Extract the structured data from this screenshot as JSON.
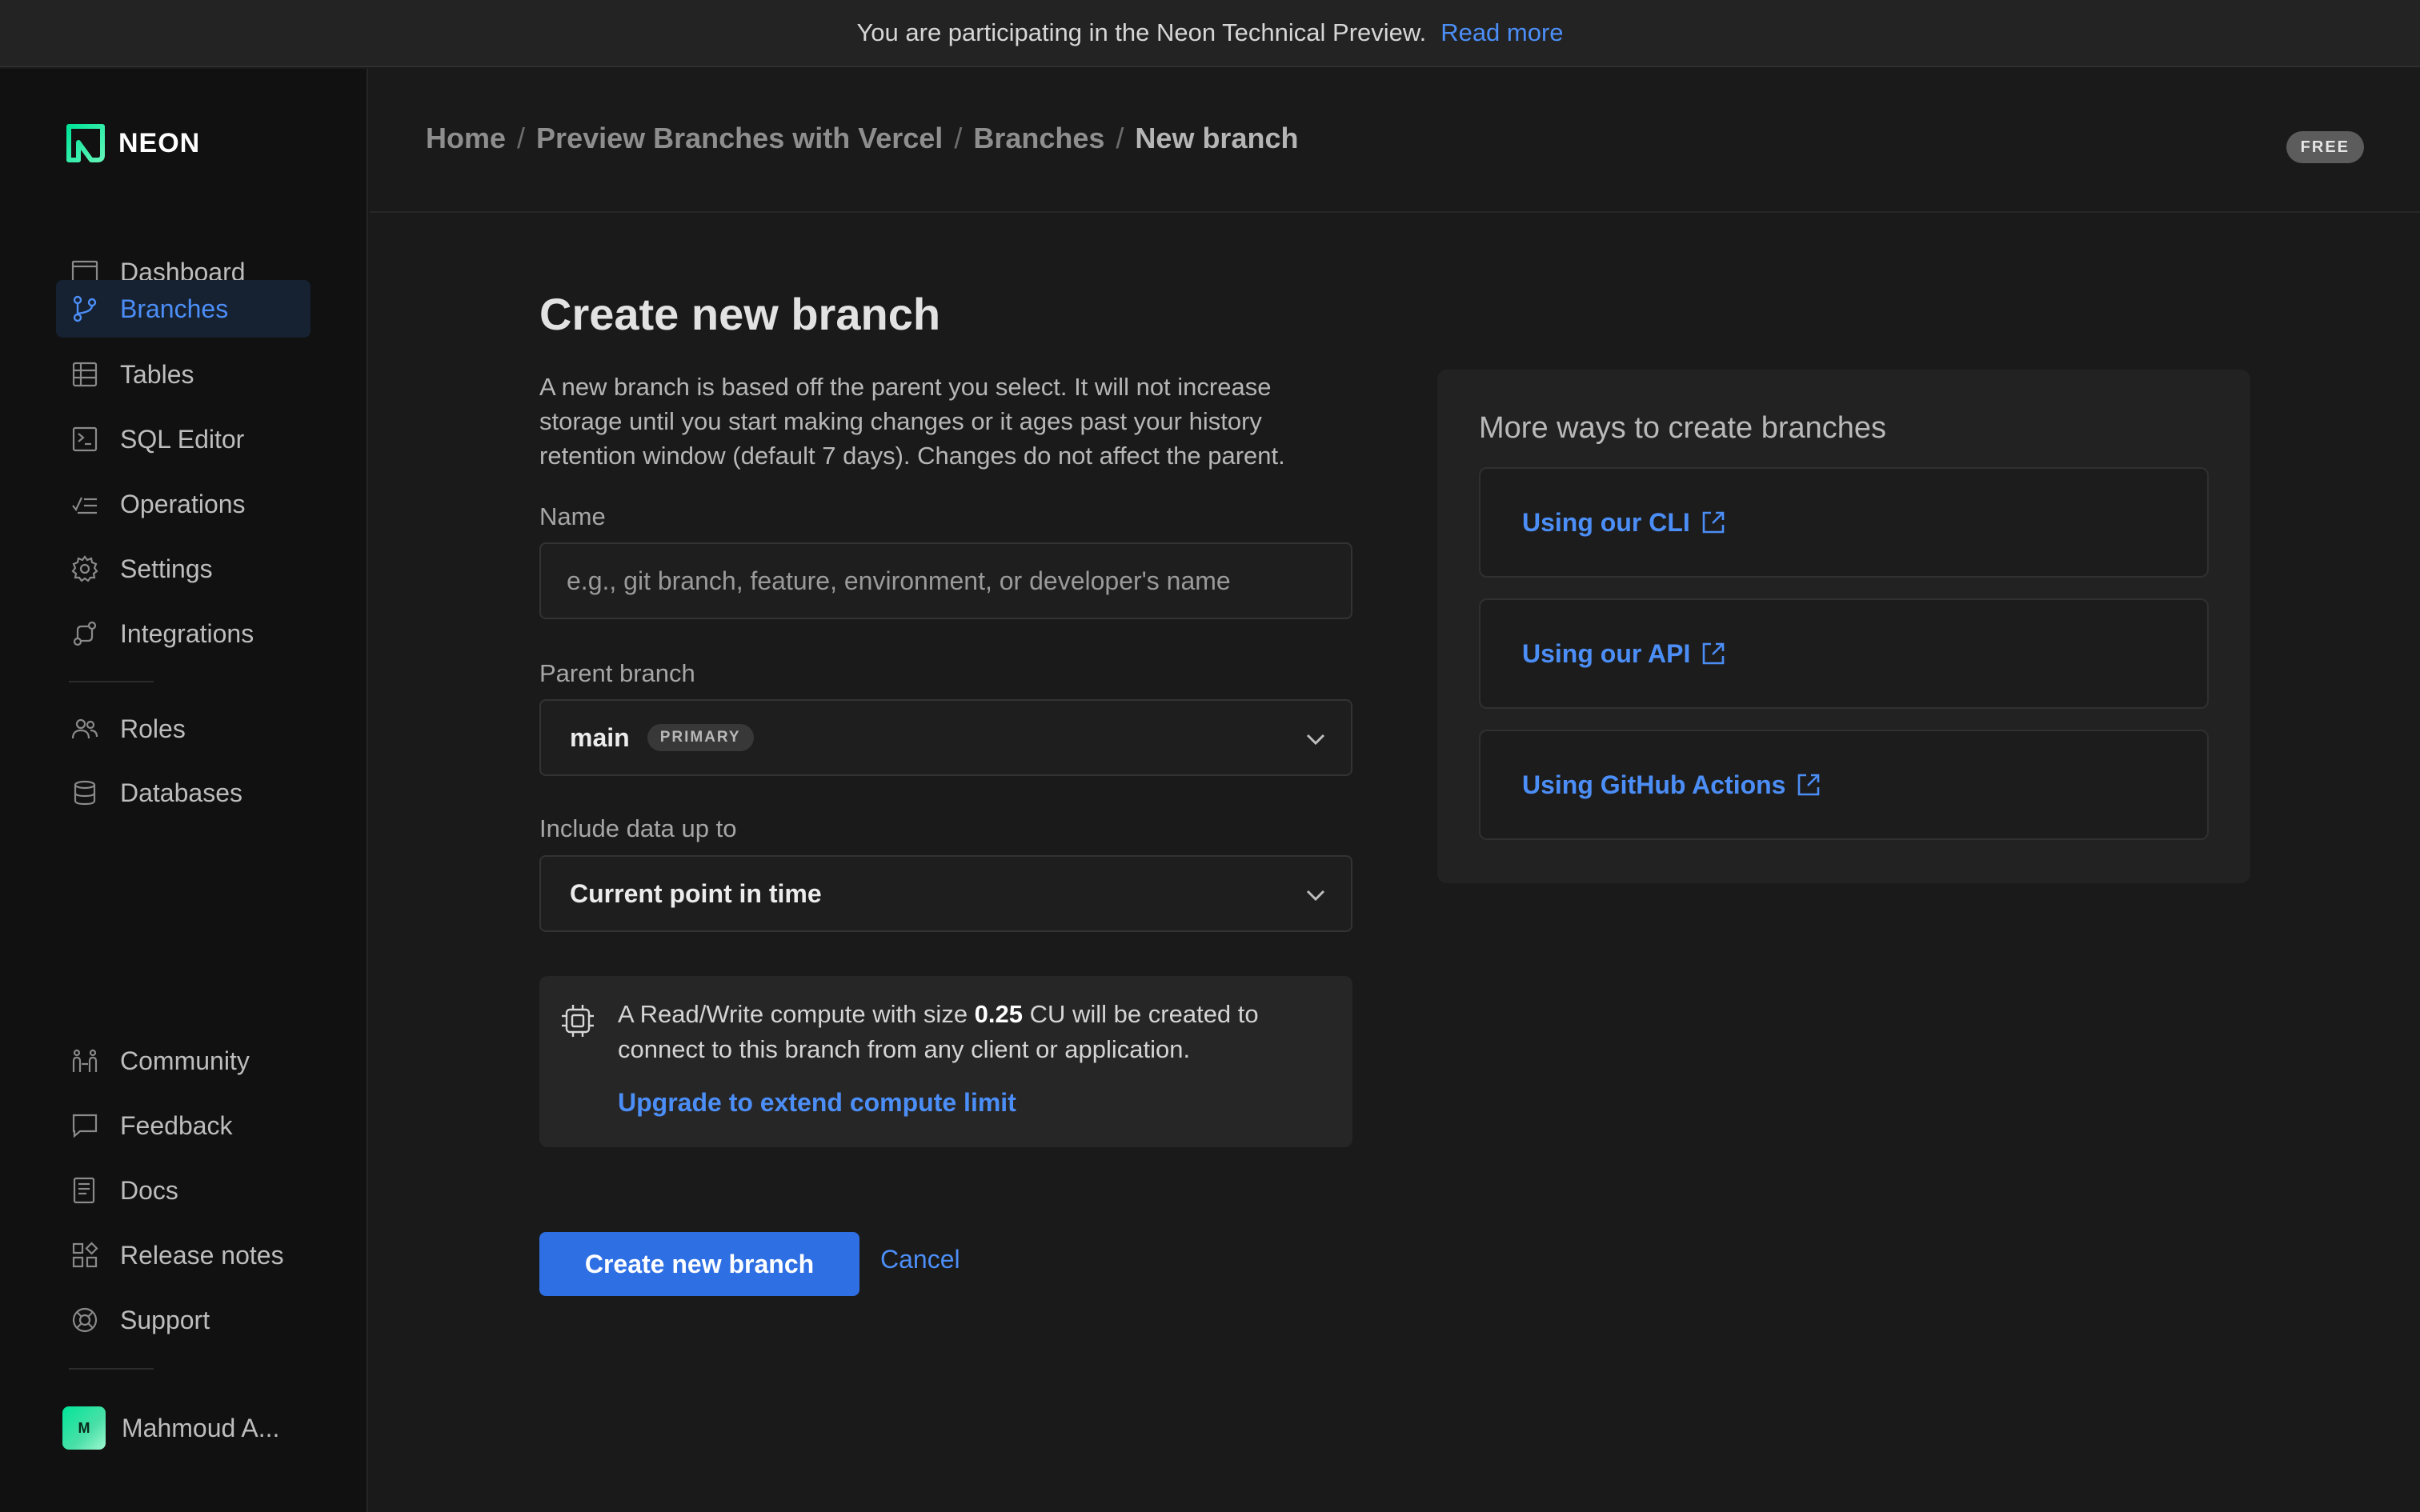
{
  "banner": {
    "text": "You are participating in the Neon Technical Preview.",
    "link": "Read more"
  },
  "brand": {
    "name": "NEON",
    "logo_icon": "neon-logo-icon",
    "accent": "#00e599"
  },
  "sidebar": {
    "items": [
      {
        "label": "Dashboard",
        "icon": "dashboard-icon",
        "active": false
      },
      {
        "label": "Branches",
        "icon": "branch-icon",
        "active": true
      },
      {
        "label": "Tables",
        "icon": "table-icon",
        "active": false
      },
      {
        "label": "SQL Editor",
        "icon": "terminal-icon",
        "active": false
      },
      {
        "label": "Operations",
        "icon": "operations-icon",
        "active": false
      },
      {
        "label": "Settings",
        "icon": "gear-icon",
        "active": false
      },
      {
        "label": "Integrations",
        "icon": "integrations-icon",
        "active": false
      }
    ],
    "secondary_items": [
      {
        "label": "Roles",
        "icon": "users-icon"
      },
      {
        "label": "Databases",
        "icon": "database-icon"
      }
    ],
    "footer_items": [
      {
        "label": "Community",
        "icon": "community-icon"
      },
      {
        "label": "Feedback",
        "icon": "chat-icon"
      },
      {
        "label": "Docs",
        "icon": "docs-icon"
      },
      {
        "label": "Release notes",
        "icon": "grid-icon"
      },
      {
        "label": "Support",
        "icon": "lifebuoy-icon"
      }
    ],
    "user": {
      "name": "Mahmoud A...",
      "initial": "M"
    }
  },
  "header": {
    "breadcrumbs": [
      "Home",
      "Preview Branches with Vercel",
      "Branches",
      "New branch"
    ],
    "separator": "/",
    "plan_badge": "FREE"
  },
  "form": {
    "title": "Create new branch",
    "description": "A new branch is based off the parent you select. It will not increase storage until you start making changes or it ages past your history retention window (default 7 days). Changes do not affect the parent.",
    "name_label": "Name",
    "name_placeholder": "e.g., git branch, feature, environment, or developer's name",
    "name_value": "",
    "parent_label": "Parent branch",
    "parent_value": "main",
    "parent_tag": "PRIMARY",
    "data_label": "Include data up to",
    "data_value": "Current point in time",
    "notice_prefix": "A Read/Write compute with size ",
    "notice_size": "0.25",
    "notice_suffix": " CU will be created to connect to this branch from any client or application.",
    "notice_link": "Upgrade to extend compute limit",
    "submit_label": "Create new branch",
    "cancel_label": "Cancel"
  },
  "more_ways": {
    "title": "More ways to create branches",
    "links": [
      "Using our CLI",
      "Using our API",
      "Using GitHub Actions"
    ]
  },
  "colors": {
    "link": "#4c8ef7",
    "primary_button": "#2f6fe4",
    "active_nav_bg": "#162131"
  }
}
